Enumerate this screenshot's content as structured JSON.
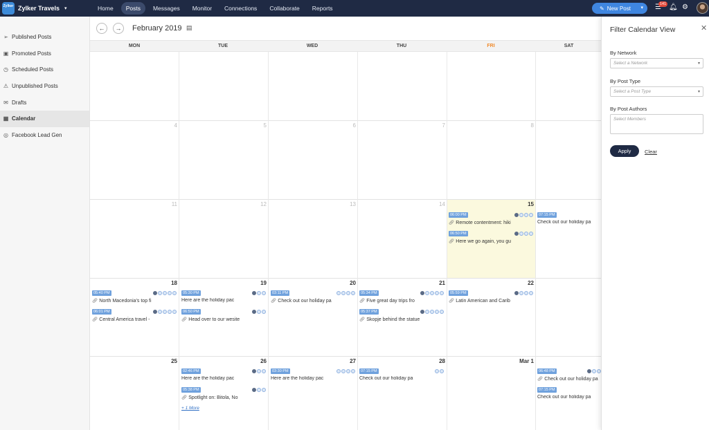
{
  "header": {
    "brand": "Zylker Travels",
    "logo_text": "Zylker",
    "nav": [
      {
        "label": "Home"
      },
      {
        "label": "Posts"
      },
      {
        "label": "Messages"
      },
      {
        "label": "Monitor"
      },
      {
        "label": "Connections"
      },
      {
        "label": "Collaborate"
      },
      {
        "label": "Reports"
      }
    ],
    "active_nav": "Posts",
    "new_post_label": "New Post",
    "notification_count": "141"
  },
  "sidebar": {
    "items": [
      {
        "label": "Published Posts",
        "icon": "send-icon"
      },
      {
        "label": "Promoted Posts",
        "icon": "promote-icon"
      },
      {
        "label": "Scheduled Posts",
        "icon": "clock-icon"
      },
      {
        "label": "Unpublished Posts",
        "icon": "warning-icon"
      },
      {
        "label": "Drafts",
        "icon": "drafts-icon"
      },
      {
        "label": "Calendar",
        "icon": "calendar-icon"
      },
      {
        "label": "Facebook Lead Gen",
        "icon": "lead-gen-icon"
      }
    ],
    "active": "Calendar"
  },
  "calendar": {
    "month": "February 2019",
    "weekdays": [
      "MON",
      "TUE",
      "WED",
      "THU",
      "FRI",
      "SAT"
    ],
    "day_numbers": {
      "row2": [
        "4",
        "5",
        "6",
        "7",
        "8"
      ],
      "row3": [
        "11",
        "12",
        "13",
        "14",
        "15"
      ],
      "row4": [
        "18",
        "19",
        "20",
        "21",
        "22"
      ],
      "row5": [
        "25",
        "26",
        "27",
        "28",
        "Mar 1"
      ]
    },
    "posts": {
      "fri15a": {
        "time": "06:00 PM",
        "text": "Remote contentment: hiki"
      },
      "fri15b": {
        "time": "06:50 PM",
        "text": "Here we go again, you gu"
      },
      "sat16a": {
        "time": "07:15 PM",
        "text": "Check out our holiday pa"
      },
      "mon18a": {
        "time": "05:40 PM",
        "text": "North Macedonia's top fi"
      },
      "mon18b": {
        "time": "06:01 PM",
        "text": "Central America travel -"
      },
      "tue19a": {
        "time": "05:30 PM",
        "text": "Here are the holiday pac"
      },
      "tue19b": {
        "time": "06:50 PM",
        "text": "Head over to our wesite"
      },
      "wed20a": {
        "time": "03:11 PM",
        "text": "Check out our holiday pa"
      },
      "thu21a": {
        "time": "05:34 PM",
        "text": "Five great day trips fro"
      },
      "thu21b": {
        "time": "05:37 PM",
        "text": "Skopje behind the statue"
      },
      "fri22a": {
        "time": "05:59 PM",
        "text": "Latin American and Carib"
      },
      "tue26a": {
        "time": "02:46 PM",
        "text": "Here are the holiday pac"
      },
      "tue26b": {
        "time": "05:38 PM",
        "text": "Spotlight on: Bitola, No"
      },
      "wed27a": {
        "time": "03:30 PM",
        "text": "Here are the holiday pac"
      },
      "thu28a": {
        "time": "07:15 PM",
        "text": "Check out our holiday pa"
      },
      "sat2a": {
        "time": "06:48 PM",
        "text": "Check out our holiday pa"
      },
      "sat2b": {
        "time": "07:15 PM",
        "text": "Check out our holiday pa"
      }
    },
    "more_label": "+ 1 More"
  },
  "filter_panel": {
    "title": "Filter Calendar View",
    "network_label": "By Network",
    "network_placeholder": "Select a Network",
    "post_type_label": "By Post Type",
    "post_type_placeholder": "Select a Post Type",
    "authors_label": "By Post Authors",
    "authors_placeholder": "Select Members",
    "apply_label": "Apply",
    "clear_label": "Clear"
  },
  "colors": {
    "topbar": "#1f2a44",
    "accent": "#3f86e0",
    "highlight_day": "#fbf9de",
    "friday_header": "#f08a2b",
    "time_chip": "#6fa1dd"
  }
}
